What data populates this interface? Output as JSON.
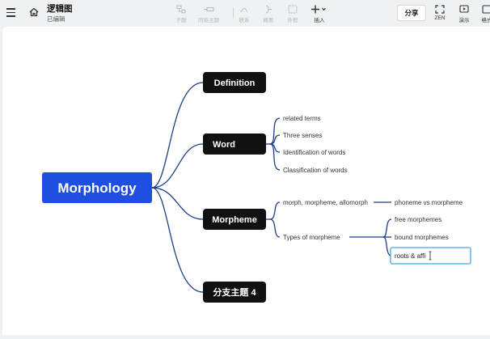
{
  "header": {
    "doc_title": "逻辑图",
    "doc_status": "已编辑"
  },
  "toolbar": {
    "subtopic": "子题",
    "parent_topic": "同级主题",
    "relation": "联系",
    "summary": "概要",
    "boundary": "外框",
    "insert": "插入",
    "share": "分享",
    "zen": "ZEN",
    "present": "演示",
    "format": "格式"
  },
  "mindmap": {
    "root": "Morphology",
    "branches": {
      "definition": "Definition",
      "word": "Word",
      "morpheme": "Morpheme",
      "branch4": "分支主题 4"
    },
    "word_children": [
      "related terms",
      "Three senses",
      "Identification of words",
      "Classification of words"
    ],
    "morpheme_children": [
      "morph, morpheme, allomorph",
      "Types of morpheme"
    ],
    "morph_child": "phoneme vs morpheme",
    "types_children": [
      "free morphemes",
      "bound morphemes"
    ],
    "editing_value": "roots & affi"
  },
  "colors": {
    "root_fill": "#1f4fe0",
    "branch_fill": "#111111",
    "connector": "#1e3f86",
    "edit_border": "#4aa8e0"
  }
}
